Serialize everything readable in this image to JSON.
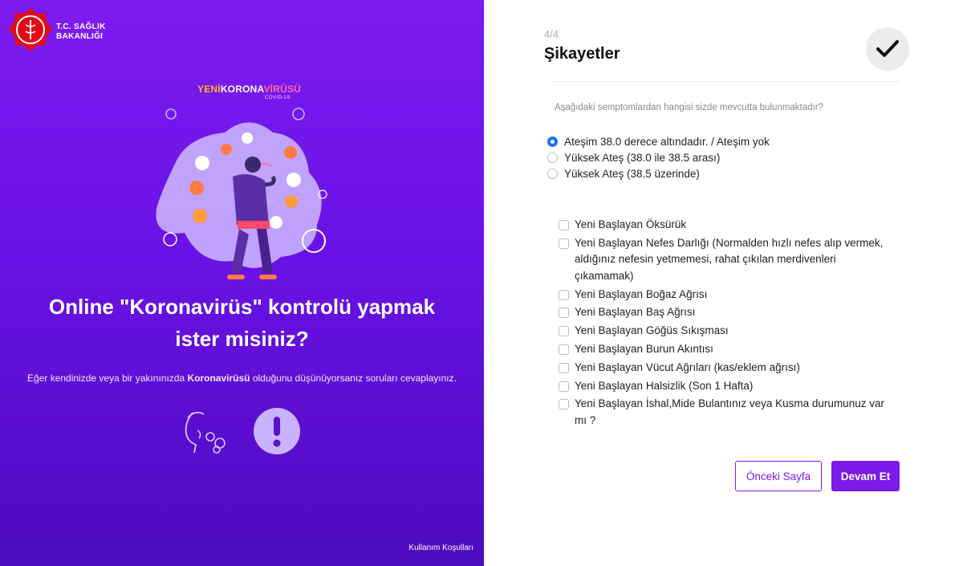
{
  "left": {
    "logo_lines": [
      "T.C. SAĞLIK",
      "BAKANLIĞI"
    ],
    "brand": {
      "yeni": "YENİ",
      "korona": "KORONA",
      "virusu": "VİRÜSÜ",
      "sub": "COVID-19"
    },
    "headline_line1": "Online \"Koronavirüs\" kontrolü yapmak",
    "headline_line2": "ister misiniz?",
    "sub_pre": "Eğer kendinizde veya bir yakınınızda ",
    "sub_bold": "Koronavirüsü",
    "sub_post": " olduğunu düşünüyorsanız soruları cevaplayınız.",
    "terms": "Kullanım Koşulları",
    "colors": {
      "bg_top": "#7d1bf0",
      "bg_bottom": "#4e0bbf",
      "logo_red": "#e30a17"
    }
  },
  "right": {
    "step": "4/4",
    "title": "Şikayetler",
    "question": "Aşağıdaki semptomlardan hangisi sizde mevcutta bulunmaktadır?",
    "radios": [
      {
        "label": "Ateşim 38.0 derece altındadır. / Ateşim yok",
        "selected": true
      },
      {
        "label": "Yüksek Ateş (38.0 ile 38.5 arası)",
        "selected": false
      },
      {
        "label": "Yüksek Ateş (38.5 üzerinde)",
        "selected": false
      }
    ],
    "checkboxes": [
      "Yeni Başlayan Öksürük",
      "Yeni Başlayan Nefes Darlığı (Normalden hızlı nefes alıp vermek, aldığınız nefesin yetmemesi, rahat çıkılan merdivenleri çıkamamak)",
      "Yeni Başlayan Boğaz Ağrısı",
      "Yeni Başlayan Baş Ağrısı",
      "Yeni Başlayan Göğüs Sıkışması",
      "Yeni Başlayan Burun Akıntısı",
      "Yeni Başlayan Vücut Ağrıları (kas/eklem ağrısı)",
      "Yeni Başlayan Halsizlik (Son 1 Hafta)",
      "Yeni Başlayan İshal,Mide Bulantınız veya Kusma durumunuz var mı ?"
    ],
    "prev_label": "Önceki Sayfa",
    "next_label": "Devam Et",
    "colors": {
      "accent": "#7a1be8",
      "radio_selected": "#1a73e8"
    }
  }
}
